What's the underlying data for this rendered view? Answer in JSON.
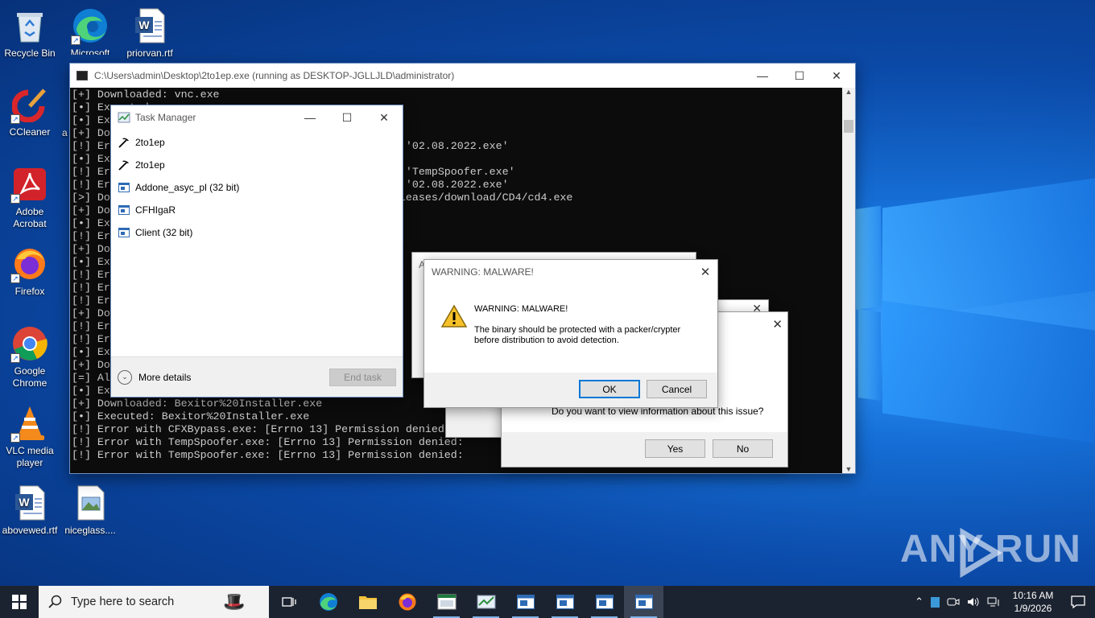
{
  "desktop": {
    "icons": [
      {
        "label": "Recycle Bin"
      },
      {
        "label": "Microsoft Edge"
      },
      {
        "label": "priorvan.rtf"
      },
      {
        "label": "CCleaner"
      },
      {
        "label": "Adobe Acrobat"
      },
      {
        "label": "Firefox"
      },
      {
        "label": "Google Chrome"
      },
      {
        "label": "VLC media player"
      },
      {
        "label": "abovewed.rtf"
      },
      {
        "label": "niceglass...."
      }
    ],
    "watermark": "ANY RUN"
  },
  "console": {
    "title": "C:\\Users\\admin\\Desktop\\2to1ep.exe (running as DESKTOP-JGLLJLD\\administrator)",
    "lines": [
      "[+] Downloaded: vnc.exe",
      "[•] Executed: vnc.exe",
      "[•] Exe",
      "[+] Dow",
      "[!] Err                                     denied: '02.08.2022.exe'",
      "[•] Exe",
      "[!] Err                                   n denied: 'TempSpoofer.exe'",
      "[!] Err                                     denied: '02.08.2022.exe'",
      "[>] Dow                                 oyal/CD4/releases/download/CD4/cd4.exe",
      "[+] Dow",
      "[•] Exe",
      "[!] Err                                  : ''",
      "[+] Dow",
      "[•] Exe",
      "[!] Err                                   n",
      "[!] Err                                   d",
      "[!] Err",
      "[+] Dow",
      "[!] Err",
      "[!] Err",
      "[•] Exe",
      "[+] Dow",
      "[=] Alr",
      "[•] Exe",
      "[+] Downloaded: Bexitor%20Installer.exe",
      "[•] Executed: Bexitor%20Installer.exe",
      "[!] Error with CFXBypass.exe: [Errno 13] Permission denied",
      "[!] Error with TempSpoofer.exe: [Errno 13] Permission denied:",
      "[!] Error with TempSpoofer.exe: [Errno 13] Permission denied:"
    ]
  },
  "taskmgr": {
    "title": "Task Manager",
    "processes": [
      {
        "name": "2to1ep",
        "icon": "pickaxe-icon"
      },
      {
        "name": "2to1ep",
        "icon": "pickaxe-icon"
      },
      {
        "name": "Addone_asyc_pl (32 bit)",
        "icon": "app-window-icon"
      },
      {
        "name": "CFHIgaR",
        "icon": "app-window-icon"
      },
      {
        "name": "Client (32 bit)",
        "icon": "app-window-icon"
      }
    ],
    "more_details": "More details",
    "end_task": "End task"
  },
  "warning": {
    "title": "WARNING: MALWARE!",
    "heading": "WARNING: MALWARE!",
    "message": "The binary should be protected with a packer/crypter before distribution to avoid detection.",
    "ok": "OK",
    "cancel": "Cancel"
  },
  "behind_dialog": {
    "title_fragment": "A",
    "question": "Do you want to view information about this issue?",
    "yes": "Yes",
    "no": "No"
  },
  "taskbar": {
    "search_placeholder": "Type here to search",
    "time": "10:16 AM",
    "date": "1/9/2026"
  }
}
